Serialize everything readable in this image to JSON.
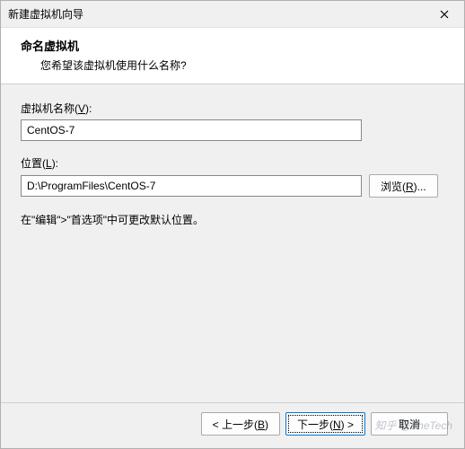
{
  "titlebar": {
    "title": "新建虚拟机向导",
    "close_icon": "close"
  },
  "header": {
    "title": "命名虚拟机",
    "subtitle": "您希望该虚拟机使用什么名称?"
  },
  "fields": {
    "name": {
      "label_pre": "虚拟机名称(",
      "label_key": "V",
      "label_post": "):",
      "value": "CentOS-7"
    },
    "location": {
      "label_pre": "位置(",
      "label_key": "L",
      "label_post": "):",
      "value": "D:\\ProgramFiles\\CentOS-7"
    },
    "browse": {
      "label_pre": "浏览(",
      "label_key": "R",
      "label_post": ")..."
    }
  },
  "hint": "在\"编辑\">\"首选项\"中可更改默认位置。",
  "footer": {
    "back": {
      "pre": "< 上一步(",
      "key": "B",
      "post": ")"
    },
    "next": {
      "pre": "下一步(",
      "key": "N",
      "post": ") >"
    },
    "cancel": {
      "label": "取消"
    }
  },
  "watermark": "知乎 @SheTech"
}
